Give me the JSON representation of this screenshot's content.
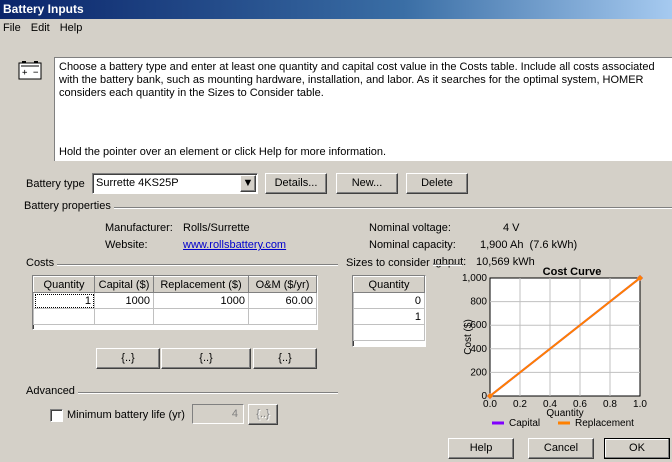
{
  "window": {
    "title": "Battery Inputs"
  },
  "menu": [
    "File",
    "Edit",
    "Help"
  ],
  "info": {
    "text": "Choose a battery type and enter at least one quantity and capital cost value in the Costs table. Include all costs associated with the battery bank, such as mounting hardware, installation, and labor. As it searches for the optimal system, HOMER considers each quantity in the Sizes to Consider table.",
    "hint": "Hold the pointer over an element or click Help for more information."
  },
  "battery_type": {
    "label": "Battery type",
    "selected": "Surrette 4KS25P",
    "details_label": "Details...",
    "new_label": "New...",
    "delete_label": "Delete"
  },
  "properties": {
    "title": "Battery properties",
    "manufacturer_label": "Manufacturer:",
    "manufacturer": "Rolls/Surrette",
    "website_label": "Website:",
    "website": "www.rollsbattery.com",
    "voltage_label": "Nominal voltage:",
    "voltage": "4 V",
    "capacity_label": "Nominal capacity:",
    "capacity": "1,900 Ah  (7.6 kWh)",
    "throughput_label": "Lifetime throughput:",
    "throughput": "10,569 kWh"
  },
  "costs": {
    "title": "Costs",
    "headers": [
      "Quantity",
      "Capital ($)",
      "Replacement ($)",
      "O&M ($/yr)"
    ],
    "rows": [
      [
        "1",
        "1000",
        "1000",
        "60.00"
      ]
    ],
    "button_label": "{..}"
  },
  "sizes": {
    "title": "Sizes to consider",
    "header": "Quantity",
    "values": [
      "0",
      "1"
    ]
  },
  "advanced": {
    "title": "Advanced",
    "min_life_label": "Minimum battery life (yr)",
    "min_life_value": "4",
    "min_life_checked": false,
    "button_label": "{..}"
  },
  "chart_data": {
    "type": "line",
    "title": "Cost Curve",
    "xlabel": "Quantity",
    "ylabel": "Cost ($)",
    "xlim": [
      0,
      1
    ],
    "ylim": [
      0,
      1000
    ],
    "xticks": [
      "0.0",
      "0.2",
      "0.4",
      "0.6",
      "0.8",
      "1.0"
    ],
    "yticks": [
      "0",
      "200",
      "400",
      "600",
      "800",
      "1,000"
    ],
    "series": [
      {
        "name": "Capital",
        "color": "#8000ff",
        "x": [
          0,
          1
        ],
        "y": [
          0,
          1000
        ]
      },
      {
        "name": "Replacement",
        "color": "#ff8000",
        "x": [
          0,
          1
        ],
        "y": [
          0,
          1000
        ]
      }
    ],
    "grid": true,
    "legend": "bottom"
  },
  "footer": {
    "help_label": "Help",
    "cancel_label": "Cancel",
    "ok_label": "OK"
  },
  "icons": {
    "info": "battery-icon"
  }
}
